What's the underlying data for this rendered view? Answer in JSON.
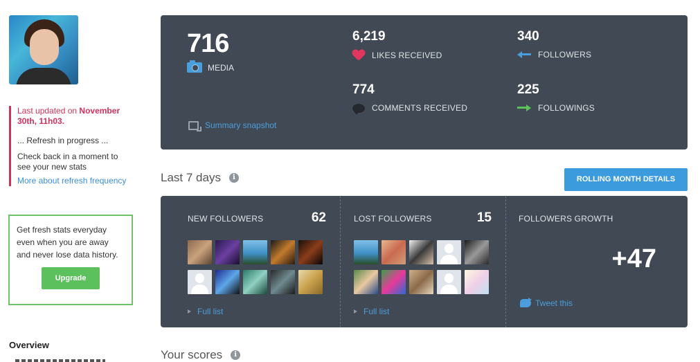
{
  "sidebar": {
    "status": {
      "updated_prefix": "Last updated on ",
      "updated_date": "November 30th, 11h03.",
      "refresh": "... Refresh in progress ...",
      "check_back": "Check back in a moment to see your new stats",
      "more_link": "More about refresh frequency"
    },
    "upgrade": {
      "text": "Get fresh stats everyday even when you are away and never lose data history.",
      "button": "Upgrade"
    },
    "nav": {
      "overview": "Overview"
    }
  },
  "summary": {
    "media": {
      "count": "716",
      "label": "MEDIA",
      "icon": "camera-icon"
    },
    "likes": {
      "count": "6,219",
      "label": "LIKES RECEIVED",
      "icon": "heart-icon"
    },
    "followers": {
      "count": "340",
      "label": "FOLLOWERS",
      "icon": "arrow-left-icon"
    },
    "comments": {
      "count": "774",
      "label": "COMMENTS RECEIVED",
      "icon": "comment-icon"
    },
    "followings": {
      "count": "225",
      "label": "FOLLOWINGS",
      "icon": "arrow-right-icon"
    },
    "snapshot_link": "Summary snapshot"
  },
  "last7": {
    "title": "Last 7 days",
    "rolling_button": "ROLLING MONTH DETAILS",
    "new_followers": {
      "label": "NEW FOLLOWERS",
      "count": "62",
      "full_list": "Full list",
      "thumbs": [
        {
          "placeholder": false,
          "bg": "linear-gradient(135deg,#8b6a4f,#c9a27d 50%,#5b4433)"
        },
        {
          "placeholder": false,
          "bg": "linear-gradient(135deg,#2a1a4f,#6b3fa0 50%,#1a1030)"
        },
        {
          "placeholder": false,
          "bg": "linear-gradient(180deg,#7fc0e8,#3e8fc4 55%,#2a4d2a)"
        },
        {
          "placeholder": false,
          "bg": "linear-gradient(135deg,#1a1a1a,#c27b2d 50%,#2a1a10)"
        },
        {
          "placeholder": false,
          "bg": "linear-gradient(135deg,#1a0f0a,#8a3d1a 50%,#0a0505)"
        },
        {
          "placeholder": true,
          "bg": ""
        },
        {
          "placeholder": false,
          "bg": "linear-gradient(135deg,#1c2d8f,#5da6e8 50%,#111)"
        },
        {
          "placeholder": false,
          "bg": "linear-gradient(135deg,#2d7a6a,#8fd0c2 50%,#1a4a3a)"
        },
        {
          "placeholder": false,
          "bg": "linear-gradient(135deg,#2a2a2a,#6f8a8f 50%,#1a1a1a)"
        },
        {
          "placeholder": false,
          "bg": "linear-gradient(135deg,#e8d9a8,#c9a14d 50%,#8a6a2a)"
        }
      ]
    },
    "lost_followers": {
      "label": "LOST FOLLOWERS",
      "count": "15",
      "full_list": "Full list",
      "thumbs": [
        {
          "placeholder": false,
          "bg": "linear-gradient(180deg,#7fc0e8,#3e8fc4 55%,#2a4d2a)"
        },
        {
          "placeholder": false,
          "bg": "linear-gradient(135deg,#e8b88f,#c96a4f 50%,#d0a07a)"
        },
        {
          "placeholder": false,
          "bg": "linear-gradient(135deg,#f0f0f0,#3a3a3a 50%,#d8c0a8)"
        },
        {
          "placeholder": true,
          "bg": ""
        },
        {
          "placeholder": false,
          "bg": "linear-gradient(135deg,#1a1a1a,#9a9a9a 50%,#2a2a2a)"
        },
        {
          "placeholder": false,
          "bg": "linear-gradient(135deg,#5a8a4a,#e8c8a0 50%,#2a4a8a)"
        },
        {
          "placeholder": false,
          "bg": "linear-gradient(135deg,#3aa04a,#e83a9a 50%,#2a6ad0)"
        },
        {
          "placeholder": false,
          "bg": "linear-gradient(135deg,#d0b08a,#8a6a4a 50%,#e8d8c0)"
        },
        {
          "placeholder": true,
          "bg": ""
        },
        {
          "placeholder": false,
          "bg": "linear-gradient(135deg,#fff8e0,#f0d0e8 50%,#c0e0f0)"
        }
      ]
    },
    "growth": {
      "label": "FOLLOWERS GROWTH",
      "value": "+47",
      "tweet": "Tweet this"
    }
  },
  "scores": {
    "title": "Your scores"
  }
}
